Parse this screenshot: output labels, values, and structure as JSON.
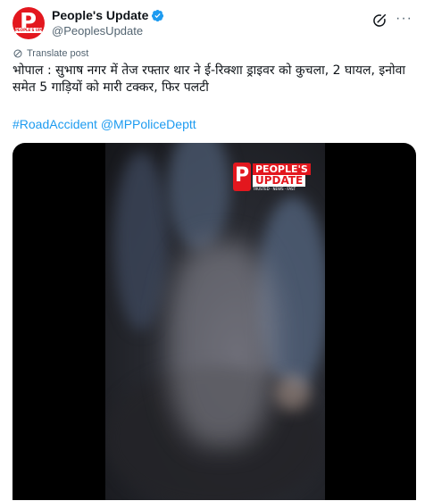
{
  "post": {
    "display_name": "People's Update",
    "handle": "@PeoplesUpdate",
    "translate_label": "Translate post",
    "text": "भोपाल : सुभाष नगर में तेज रफ्तार थार ने ई-रिक्शा ड्राइवर को कुचला, 2 घायल, इनोवा समेत 5 गाड़ियों को मारी टक्कर, फिर पलटी",
    "hashtag": "#RoadAccident",
    "mention": "@MPPoliceDeptt"
  },
  "avatar": {
    "letter": "P",
    "band_text": "PEOPLE'S UPDATE"
  },
  "video_logo": {
    "letter": "P",
    "line1": "PEOPLE'S",
    "line2": "UPDATE",
    "tagline": "TRUSTED · NEWS · FAST"
  },
  "icons": {
    "verified": "verified-badge-icon",
    "grok": "grok-icon",
    "more": "more-options-icon",
    "translate": "translate-icon"
  },
  "colors": {
    "brand_red": "#e3171e",
    "link_blue": "#1d9bf0",
    "verified_blue": "#1d9bf0",
    "muted": "#536471"
  }
}
